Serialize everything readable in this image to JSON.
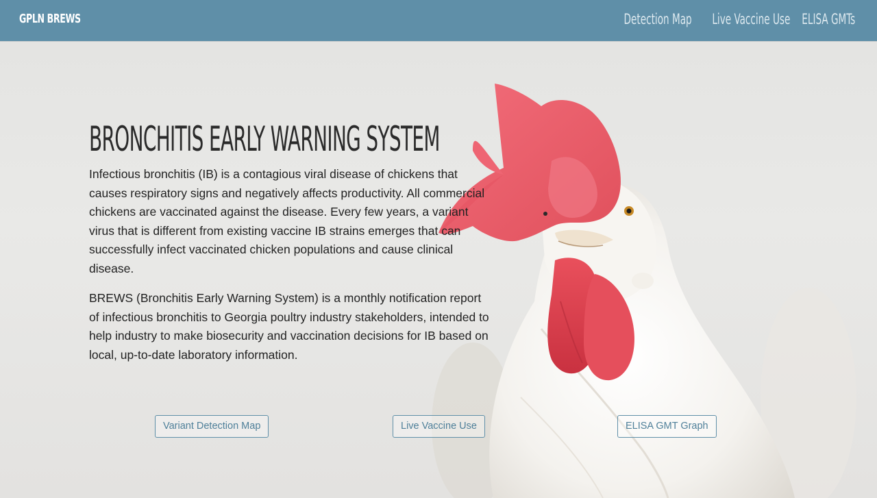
{
  "navbar": {
    "brand": "GPLN BREWS",
    "links": [
      "Detection Map",
      "Live Vaccine Use",
      "ELISA GMTs"
    ]
  },
  "hero": {
    "title": "BRONCHITIS EARLY WARNING SYSTEM",
    "paragraphs": [
      "Infectious bronchitis (IB) is a contagious viral disease of chickens that causes respiratory signs and negatively affects productivity. All commercial chickens are vaccinated against the disease. Every few years, a variant virus that is different from existing vaccine IB strains emerges that can successfully infect vaccinated chicken populations and cause clinical disease.",
      "BREWS (Bronchitis Early Warning System) is a monthly notification report of infectious bronchitis to Georgia poultry industry stakeholders, intended to help industry to make biosecurity and vaccination decisions for IB based on local, up-to-date laboratory information."
    ],
    "buttons": [
      "Variant Detection Map",
      "Live Vaccine Use",
      "ELISA GMT Graph"
    ],
    "background_image": "white-rooster-photo"
  },
  "colors": {
    "navbar": "#5f8fa8",
    "accent": "#4e7f99",
    "comb": "#e8505e"
  }
}
